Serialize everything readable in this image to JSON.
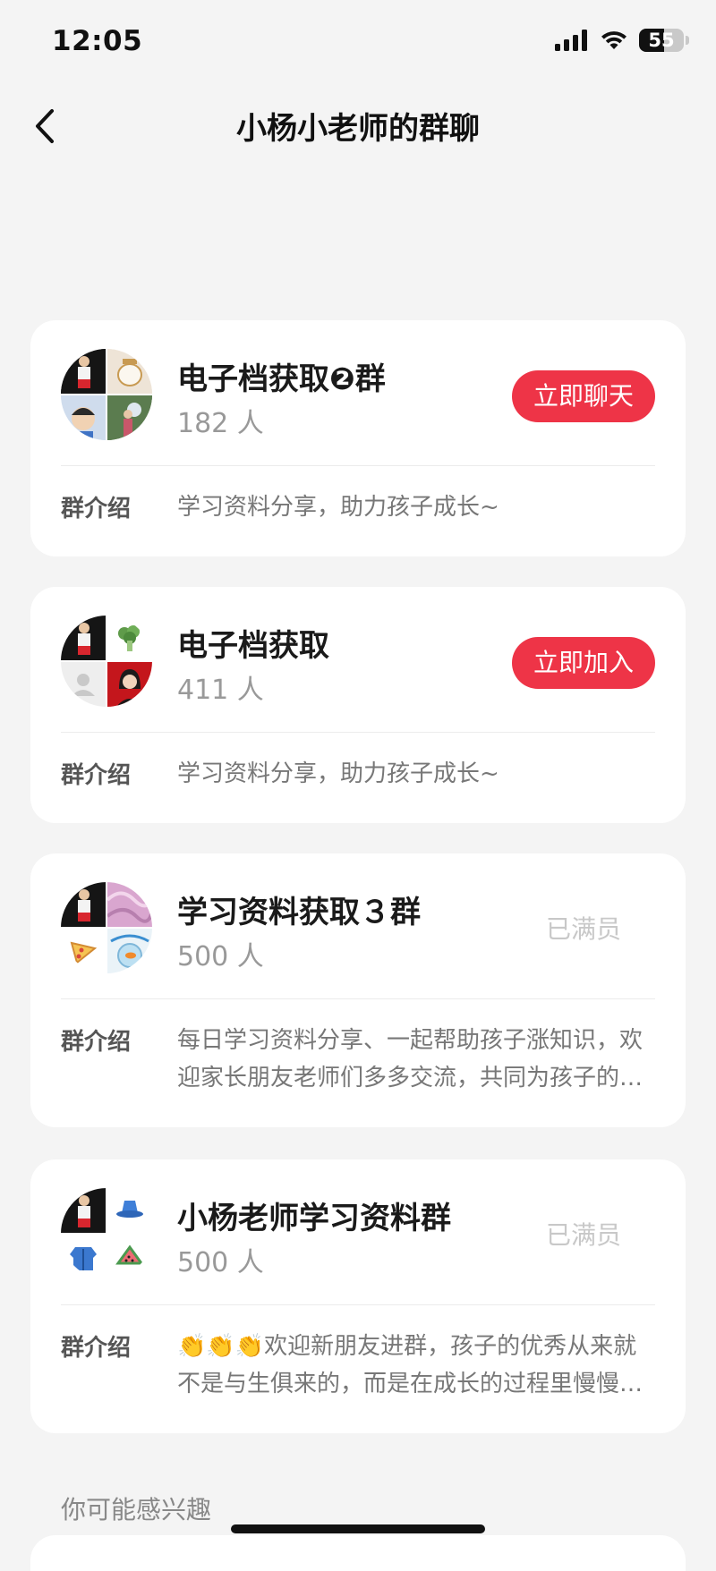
{
  "status_bar": {
    "time": "12:05",
    "battery_level": "55",
    "battery_fraction": 0.55,
    "icons": [
      "signal-icon",
      "wifi-icon",
      "battery-icon"
    ]
  },
  "nav": {
    "back_icon": "chevron-left-icon",
    "title": "小杨小老师的群聊"
  },
  "colors": {
    "accent": "#ee3447",
    "background": "#f4f4f4",
    "card": "#ffffff",
    "muted": "#999999"
  },
  "groups": [
    {
      "name": "电子档获取❷群",
      "count": "182 人",
      "action": "立即聊天",
      "intro_label": "群介绍",
      "intro": "学习资料分享，助力孩子成长~"
    },
    {
      "name": "电子档获取",
      "count": "411 人",
      "action": "立即加入",
      "intro_label": "群介绍",
      "intro": "学习资料分享，助力孩子成长~"
    },
    {
      "name": "学习资料获取３群",
      "count": "500 人",
      "status": "已满员",
      "intro_label": "群介绍",
      "intro": "每日学习资料分享、一起帮助孩子涨知识，欢迎家长朋友老师们多多交流，共同为孩子的成长助力"
    },
    {
      "name": "小杨老师学习资料群",
      "count": "500 人",
      "status": "已满员",
      "intro_label": "群介绍",
      "intro": "👏👏👏欢迎新朋友进群，孩子的优秀从来就不是与生俱来的，而是在成长的过程里慢慢养成的"
    }
  ],
  "section": {
    "title": "你可能感兴趣"
  }
}
